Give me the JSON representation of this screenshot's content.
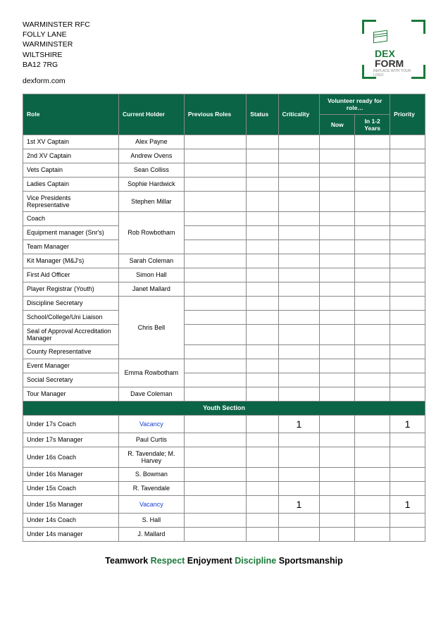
{
  "address": [
    "WARMINSTER RFC",
    "FOLLY LANE",
    "WARMINSTER",
    "WILTSHIRE",
    "BA12 7RG"
  ],
  "website": "dexform.com",
  "logo": {
    "line1": "DEX",
    "line2": "FORM",
    "sub": "REPLACE WITH YOUR LOGO"
  },
  "headers": {
    "role": "Role",
    "holder": "Current Holder",
    "prev": "Previous Roles",
    "status": "Status",
    "crit": "Criticality",
    "vol": "Volunteer ready for role…",
    "now": "Now",
    "years": "In 1-2 Years",
    "prio": "Priority"
  },
  "rows": [
    {
      "role": "1st XV Captain",
      "holder": "Alex Payne"
    },
    {
      "role": "2nd XV Captain",
      "holder": "Andrew Ovens"
    },
    {
      "role": "Vets Captain",
      "holder": "Sean Colliss"
    },
    {
      "role": "Ladies Captain",
      "holder": "Sophie Hardwick"
    },
    {
      "role": "Vice Presidents Representative",
      "holder": "Stephen Millar"
    },
    {
      "role": "Coach",
      "holder": "Rob Rowbotham",
      "merge_start": true,
      "merge_span": 3
    },
    {
      "role": "Equipment manager (Snr's)",
      "merged": true
    },
    {
      "role": "Team Manager",
      "merged": true
    },
    {
      "role": "Kit Manager (M&J's)",
      "holder": "Sarah Coleman"
    },
    {
      "role": "First Aid Officer",
      "holder": "Simon Hall"
    },
    {
      "role": "Player Registrar (Youth)",
      "holder": "Janet Mallard"
    },
    {
      "role": "Discipline Secretary",
      "holder": "Chris Bell",
      "merge_start": true,
      "merge_span": 4
    },
    {
      "role": "School/College/Uni Liaison",
      "merged": true
    },
    {
      "role": "Seal of Approval Accreditation Manager",
      "merged": true
    },
    {
      "role": "County Representative",
      "merged": true
    },
    {
      "role": "Event Manager",
      "holder": "Emma Rowbotham",
      "merge_start": true,
      "merge_span": 2
    },
    {
      "role": "Social Secretary",
      "merged": true
    },
    {
      "role": "Tour Manager",
      "holder": "Dave Coleman"
    }
  ],
  "section_label": "Youth Section",
  "youth_rows": [
    {
      "role": "Under 17s Coach",
      "holder": "Vacancy",
      "vacancy": true,
      "crit": "1",
      "prio": "1"
    },
    {
      "role": "Under 17s Manager",
      "holder": "Paul Curtis"
    },
    {
      "role": "Under 16s Coach",
      "holder": "R. Tavendale; M. Harvey"
    },
    {
      "role": "Under 16s Manager",
      "holder": "S. Bowman"
    },
    {
      "role": "Under 15s Coach",
      "holder": "R. Tavendale"
    },
    {
      "role": "Under 15s Manager",
      "holder": "Vacancy",
      "vacancy": true,
      "crit": "1",
      "prio": "1"
    },
    {
      "role": "Under 14s Coach",
      "holder": "S. Hall"
    },
    {
      "role": "Under 14s manager",
      "holder": "J. Mallard"
    }
  ],
  "motto": [
    "Teamwork",
    "Respect",
    "Enjoyment",
    "Discipline",
    "Sportsmanship"
  ]
}
